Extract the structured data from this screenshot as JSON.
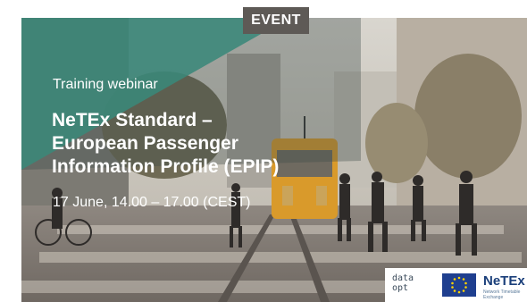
{
  "badge": {
    "label": "EVENT"
  },
  "banner": {
    "subtitle": "Training webinar",
    "title_lines": [
      "NeTEx Standard –",
      "European Passenger",
      "Information Profile (EPIP)"
    ],
    "date": "17 June, 14.00 – 17.00 (CEST)"
  },
  "logos": {
    "data_opt": [
      "data",
      "opt"
    ],
    "netex": "NeTEx",
    "netex_sub": "Network Timetable Exchange",
    "eu_icon": "eu-flag-icon"
  },
  "colors": {
    "teal_overlay": "#3aa894",
    "badge_bg": "#5e5a56",
    "tram": "#d99a2b",
    "netex_blue": "#1a3f7a",
    "eu_blue": "#1f3f8f",
    "eu_star": "#ffd400"
  }
}
